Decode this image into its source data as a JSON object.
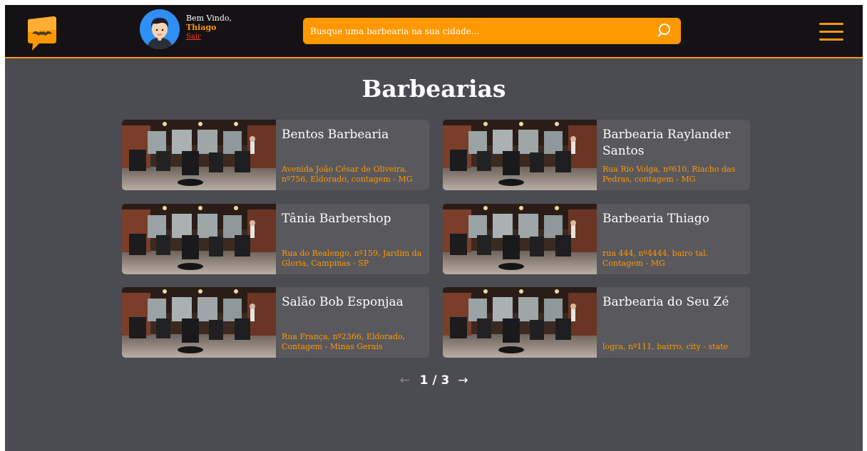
{
  "header": {
    "greeting": "Bem Vindo,",
    "username": "Thiago",
    "logout_label": "Sair",
    "search_placeholder": "Busque uma barbearia na sua cidade..."
  },
  "main": {
    "title": "Barbearias",
    "barbershops": [
      {
        "name": "Bentos Barbearia",
        "address": "Avenida João César de Oliveira, nº756, Eldorado, contagem - MG"
      },
      {
        "name": "Barbearia Raylander Santos",
        "address": "Rua Rio Volga, nº610, Riacho das Pedras, contagem - MG"
      },
      {
        "name": "Tânia Barbershop",
        "address": "Rua do Realengo, nº159, Jardim da Gloria, Campinas - SP"
      },
      {
        "name": "Barbearia Thiago",
        "address": "rua 444, nº4444, bairo tal, Contagem - MG"
      },
      {
        "name": "Salão Bob Esponjaa",
        "address": "Rua França, nº2366, Eldorado, Contagem - Minas Gerais"
      },
      {
        "name": "Barbearia do Seu Zé",
        "address": "logra, nº111, bairro, city - state"
      }
    ],
    "pagination": {
      "prev_icon": "arrow-left-icon",
      "label": "1 / 3",
      "next_icon": "arrow-right-icon"
    }
  },
  "colors": {
    "accent": "#ff9800",
    "topbar": "#141214",
    "background": "#4b4b52",
    "card": "#59585c",
    "logout": "#ff3a1f"
  }
}
